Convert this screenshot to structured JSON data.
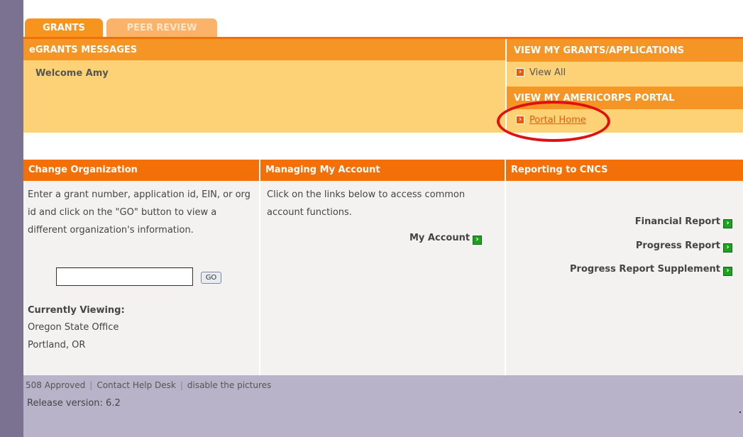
{
  "tabs": {
    "grants": "GRANTS",
    "peer_review": "PEER REVIEW"
  },
  "messages": {
    "header": "eGRANTS MESSAGES",
    "welcome": "Welcome Amy"
  },
  "grants_panel": {
    "header": "VIEW MY GRANTS/APPLICATIONS",
    "view_all": "View All"
  },
  "portal_panel": {
    "header": "VIEW MY AMERICORPS PORTAL",
    "portal_home": "Portal Home"
  },
  "change_org": {
    "header": "Change Organization",
    "description": "Enter a grant number, application id, EIN, or org id and click on the \"GO\" button to view a different organization's information.",
    "input_value": "",
    "go_label": "GO",
    "currently_viewing_label": "Currently Viewing:",
    "org_name": "Oregon State Office",
    "org_location": "Portland, OR"
  },
  "account": {
    "header": "Managing My Account",
    "description": "Click on the links below to access common account functions.",
    "my_account": "My Account"
  },
  "reporting": {
    "header": "Reporting to CNCS",
    "links": [
      "Financial Report",
      "Progress Report",
      "Progress Report Supplement"
    ]
  },
  "footer": {
    "links": [
      "508 Approved",
      "Contact Help Desk",
      "disable the pictures"
    ],
    "release": "Release version: 6.2"
  },
  "colors": {
    "accent": "#f36f07",
    "light": "#fdd276",
    "annotation": "#e01010",
    "footer": "#b8b3c8"
  }
}
